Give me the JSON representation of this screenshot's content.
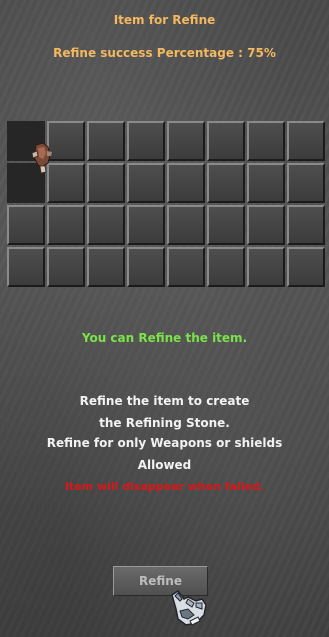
{
  "window": {
    "title": "Item for Refine",
    "rate_label": "Refine success Percentage : 75%"
  },
  "inventory": {
    "columns": 8,
    "rows": 4,
    "selected_slot": 0,
    "items": [
      {
        "slot": 0,
        "icon": "hand-equipment-icon"
      }
    ]
  },
  "status": {
    "message": "You can Refine the item.",
    "color": "#7be24a"
  },
  "description": {
    "line1": "Refine the item to create",
    "line2": "the Refining Stone.",
    "line3": "Refine for only Weapons or shields",
    "line4": "Allowed",
    "warning": "Item will disappear when failed.",
    "warning_color": "#d81818"
  },
  "actions": {
    "refine_label": "Refine"
  },
  "cursor": {
    "icon": "gauntlet-cursor-icon"
  }
}
